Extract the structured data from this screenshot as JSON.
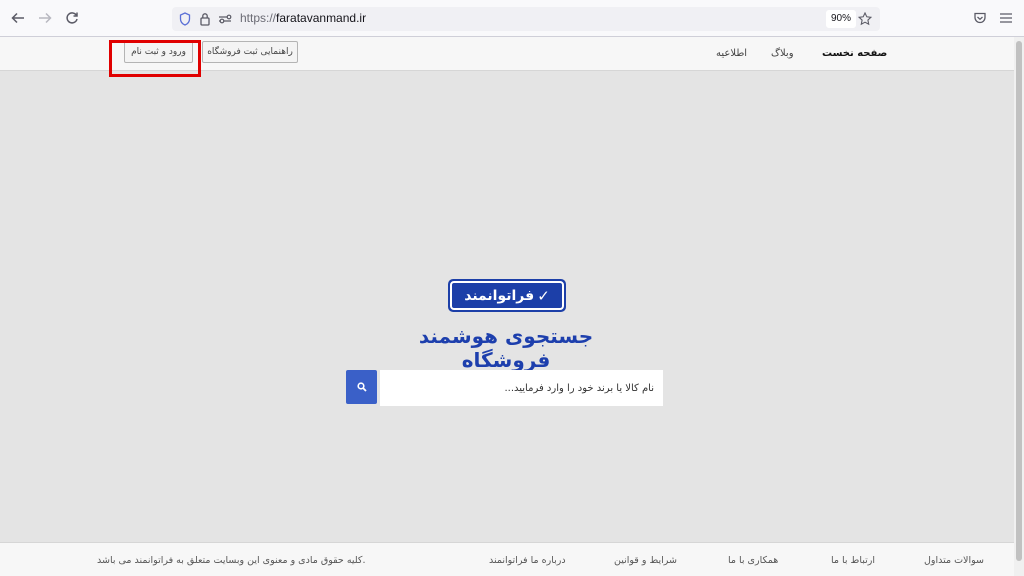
{
  "browser": {
    "url_protocol": "https://",
    "url_domain": "faratavanmand.ir",
    "zoom": "90%"
  },
  "header": {
    "nav": [
      "صفحه نخست",
      "وبلاگ",
      "اطلاعیه"
    ],
    "guide_button": "راهنمایی ثبت فروشگاه",
    "login_button": "ورود و ثبت نام"
  },
  "hero": {
    "logo_text": "فراتوانمند",
    "tagline": "جستجوی هوشمند فروشگاه",
    "search_placeholder": "نام کالا یا برند خود را وارد فرمایید..."
  },
  "footer": {
    "links": [
      "سوالات متداول",
      "ارتباط با ما",
      "همکاری با ما",
      "شرایط و قوانین",
      "درباره ما فراتوانمند"
    ],
    "copyright": "کلیه حقوق مادی و معنوی این وبسایت متعلق به فراتوانمند می باشد."
  },
  "colors": {
    "brand_blue": "#1c3fa8",
    "search_button": "#3a60c8",
    "highlight": "#e00000"
  }
}
